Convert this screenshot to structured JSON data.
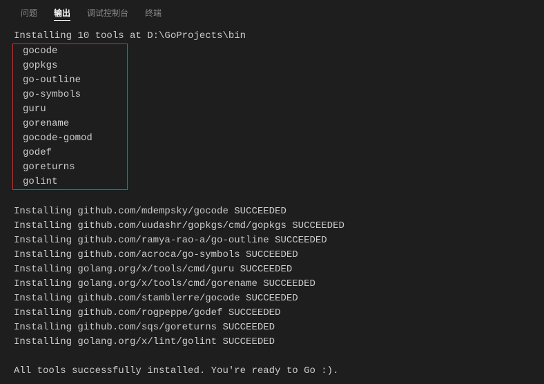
{
  "tabs": [
    {
      "label": "问题",
      "active": false
    },
    {
      "label": "输出",
      "active": true
    },
    {
      "label": "调试控制台",
      "active": false
    },
    {
      "label": "终端",
      "active": false
    }
  ],
  "output": {
    "install_header": "Installing 10 tools at D:\\GoProjects\\bin",
    "tools": [
      "gocode",
      "gopkgs",
      "go-outline",
      "go-symbols",
      "guru",
      "gorename",
      "gocode-gomod",
      "godef",
      "goreturns",
      "golint"
    ],
    "results": [
      "Installing github.com/mdempsky/gocode SUCCEEDED",
      "Installing github.com/uudashr/gopkgs/cmd/gopkgs SUCCEEDED",
      "Installing github.com/ramya-rao-a/go-outline SUCCEEDED",
      "Installing github.com/acroca/go-symbols SUCCEEDED",
      "Installing golang.org/x/tools/cmd/guru SUCCEEDED",
      "Installing golang.org/x/tools/cmd/gorename SUCCEEDED",
      "Installing github.com/stamblerre/gocode SUCCEEDED",
      "Installing github.com/rogpeppe/godef SUCCEEDED",
      "Installing github.com/sqs/goreturns SUCCEEDED",
      "Installing golang.org/x/lint/golint SUCCEEDED"
    ],
    "footer": "All tools successfully installed. You're ready to Go :)."
  }
}
